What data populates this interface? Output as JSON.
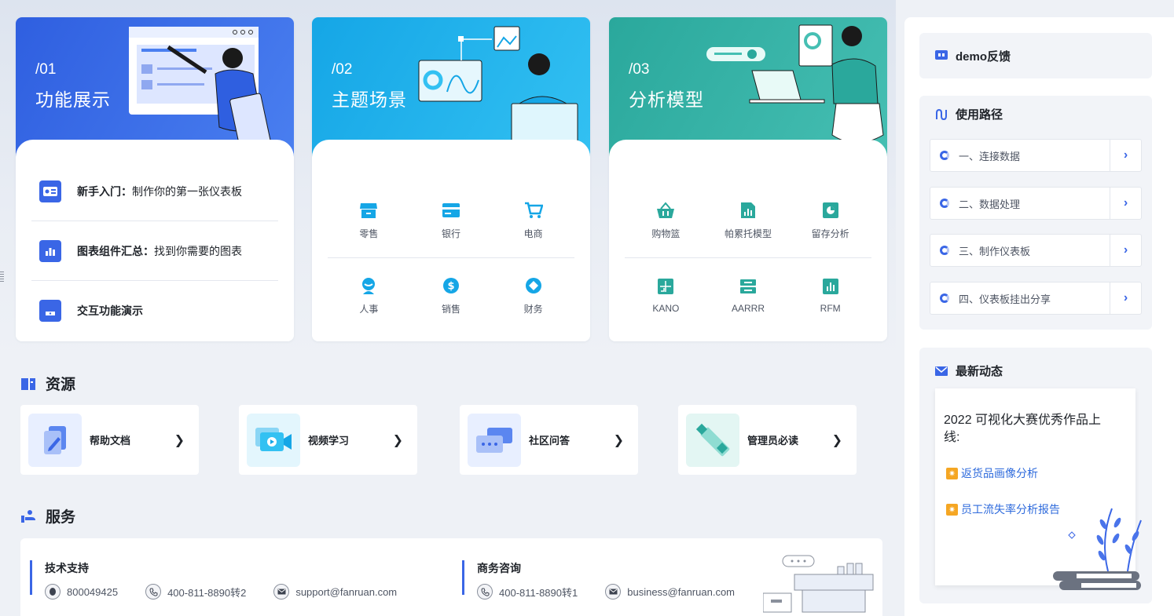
{
  "cards": [
    {
      "num": "/01",
      "title": "功能展示"
    },
    {
      "num": "/02",
      "title": "主题场景"
    },
    {
      "num": "/03",
      "title": "分析模型"
    }
  ],
  "guide": [
    {
      "bold": "新手入门：",
      "text": "制作你的第一张仪表板"
    },
    {
      "bold": "图表组件汇总：",
      "text": "找到你需要的图表"
    },
    {
      "bold": "交互功能演示",
      "text": ""
    }
  ],
  "scenes": [
    "零售",
    "银行",
    "电商",
    "人事",
    "销售",
    "财务"
  ],
  "models": [
    "购物篮",
    "帕累托模型",
    "留存分析",
    "KANO",
    "AARRR",
    "RFM"
  ],
  "resources": {
    "title": "资源",
    "items": [
      "帮助文档",
      "视频学习",
      "社区问答",
      "管理员必读"
    ]
  },
  "services": {
    "title": "服务",
    "tech": {
      "heading": "技术支持",
      "qq": "800049425",
      "phone": "400-811-8890转2",
      "email": "support@fanruan.com"
    },
    "biz": {
      "heading": "商务咨询",
      "phone": "400-811-8890转1",
      "email": "business@fanruan.com"
    }
  },
  "right": {
    "feedback": "demo反馈",
    "path_title": "使用路径",
    "paths": [
      "一、连接数据",
      "二、数据处理",
      "三、制作仪表板",
      "四、仪表板挂出分享"
    ],
    "news_title": "最新动态",
    "news_headline": "2022 可视化大赛优秀作品上线:",
    "news_links": [
      "返货品画像分析",
      "员工流失率分析报告"
    ]
  },
  "colors": {
    "blue": "#3a66e6",
    "sky": "#15a6e6",
    "teal": "#2aa89c",
    "link": "#2f6bdc"
  }
}
